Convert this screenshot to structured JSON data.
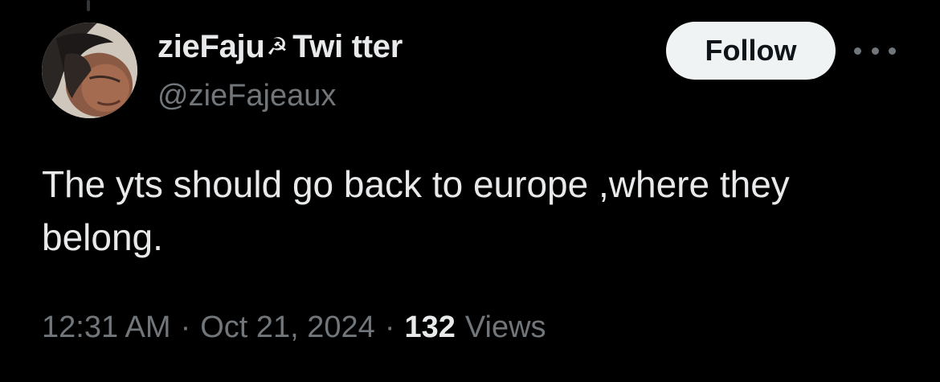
{
  "user": {
    "display_name": "zieFaju",
    "display_name_emoji": "☭",
    "display_name_suffix": "Twi tter",
    "handle": "@zieFajeaux",
    "avatar_icon": "user-avatar-photo"
  },
  "actions": {
    "follow_label": "Follow",
    "more_icon": "more-horizontal-icon"
  },
  "tweet": {
    "text": "The yts should go back to europe ,where they belong."
  },
  "meta": {
    "time": "12:31 AM",
    "separator": "·",
    "date": "Oct 21, 2024",
    "views_count": "132",
    "views_label": "Views"
  },
  "colors": {
    "background": "#000000",
    "primary_text": "#e7e9ea",
    "secondary_text": "#71767b",
    "button_bg": "#eff3f4",
    "button_text": "#0f1419"
  }
}
